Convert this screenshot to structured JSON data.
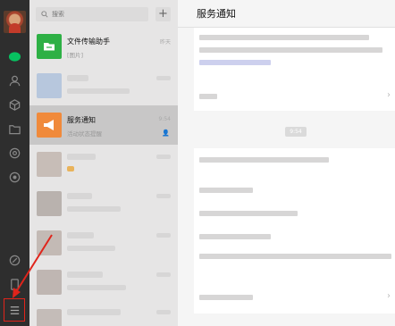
{
  "search": {
    "placeholder": "搜索"
  },
  "add_symbol": "+",
  "sidebar": {
    "icons": [
      "chat-icon",
      "contacts-icon",
      "favorites-icon",
      "files-icon",
      "moments-icon",
      "miniprogram-icon",
      "phone-icon",
      "menu-icon"
    ]
  },
  "chats": [
    {
      "name": "文件传输助手",
      "sub": "[图片]",
      "time": "昨天",
      "avatar_color": "#2eb045"
    },
    {
      "name": "服务通知",
      "sub": "活动状态提醒",
      "time": "9:54",
      "avatar_color": "#f08a3b"
    }
  ],
  "panel": {
    "title": "服务通知",
    "time_label": "9:54"
  },
  "colors": {
    "accent_green": "#07c160",
    "highlight_red": "#e0241b"
  }
}
